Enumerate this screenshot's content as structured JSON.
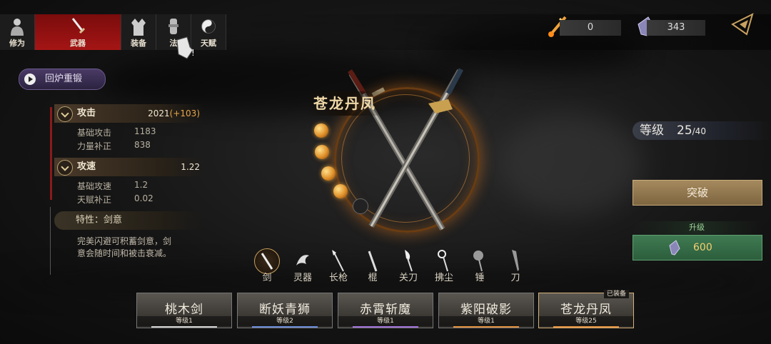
{
  "tabs": [
    {
      "label": "修为",
      "icon": "person-icon",
      "active": false
    },
    {
      "label": "武器",
      "icon": "sword-icon",
      "active": true
    },
    {
      "label": "装备",
      "icon": "robe-icon",
      "active": false
    },
    {
      "label": "法",
      "icon": "tool-icon",
      "active": false
    },
    {
      "label": "天赋",
      "icon": "yin-yang-icon",
      "active": false
    }
  ],
  "currency": {
    "flame": {
      "icon": "flame-sword-icon",
      "value": "0"
    },
    "crystal": {
      "icon": "crystal-icon",
      "value": "343"
    }
  },
  "reforge_label": "回炉重锻",
  "stats": {
    "attack": {
      "name": "攻击",
      "value": "2021",
      "bonus": "(+103)",
      "sub": [
        {
          "k": "基础攻击",
          "v": "1183"
        },
        {
          "k": "力量补正",
          "v": "838"
        }
      ]
    },
    "speed": {
      "name": "攻速",
      "value": "1.22",
      "sub": [
        {
          "k": "基础攻速",
          "v": "1.2"
        },
        {
          "k": "天赋补正",
          "v": "0.02"
        }
      ]
    }
  },
  "trait": {
    "title": "特性：剑意",
    "desc": "完美闪避可积蓄剑意，剑意会随时间和被击衰减。"
  },
  "weapon": {
    "name": "苍龙丹凤",
    "orbs_filled": 4,
    "orbs_total": 5
  },
  "level": {
    "label": "等级",
    "current": "25",
    "max": "/40"
  },
  "breakthrough_label": "突破",
  "upgrade": {
    "label": "升级",
    "cost": "600",
    "icon": "crystal-icon"
  },
  "categories": [
    {
      "label": "剑",
      "icon": "sword-icon",
      "active": true
    },
    {
      "label": "灵器",
      "icon": "dragon-icon",
      "active": false
    },
    {
      "label": "长枪",
      "icon": "spear-icon",
      "active": false
    },
    {
      "label": "棍",
      "icon": "staff-icon",
      "active": false
    },
    {
      "label": "关刀",
      "icon": "glaive-icon",
      "active": false
    },
    {
      "label": "拂尘",
      "icon": "whisk-icon",
      "active": false
    },
    {
      "label": "锤",
      "icon": "hammer-icon",
      "active": false
    },
    {
      "label": "刀",
      "icon": "blade-icon",
      "active": false
    }
  ],
  "cards": [
    {
      "name": "桃木剑",
      "level": "等级1",
      "color": "#cfcfcf"
    },
    {
      "name": "断妖青狮",
      "level": "等级2",
      "color": "#6a8ad8"
    },
    {
      "name": "赤霄斩魔",
      "level": "等级1",
      "color": "#a070d8"
    },
    {
      "name": "紫阳破影",
      "level": "等级1",
      "color": "#e09040"
    },
    {
      "name": "苍龙丹凤",
      "level": "等级25",
      "color": "#e09040"
    }
  ],
  "equipped_label": "已装备"
}
